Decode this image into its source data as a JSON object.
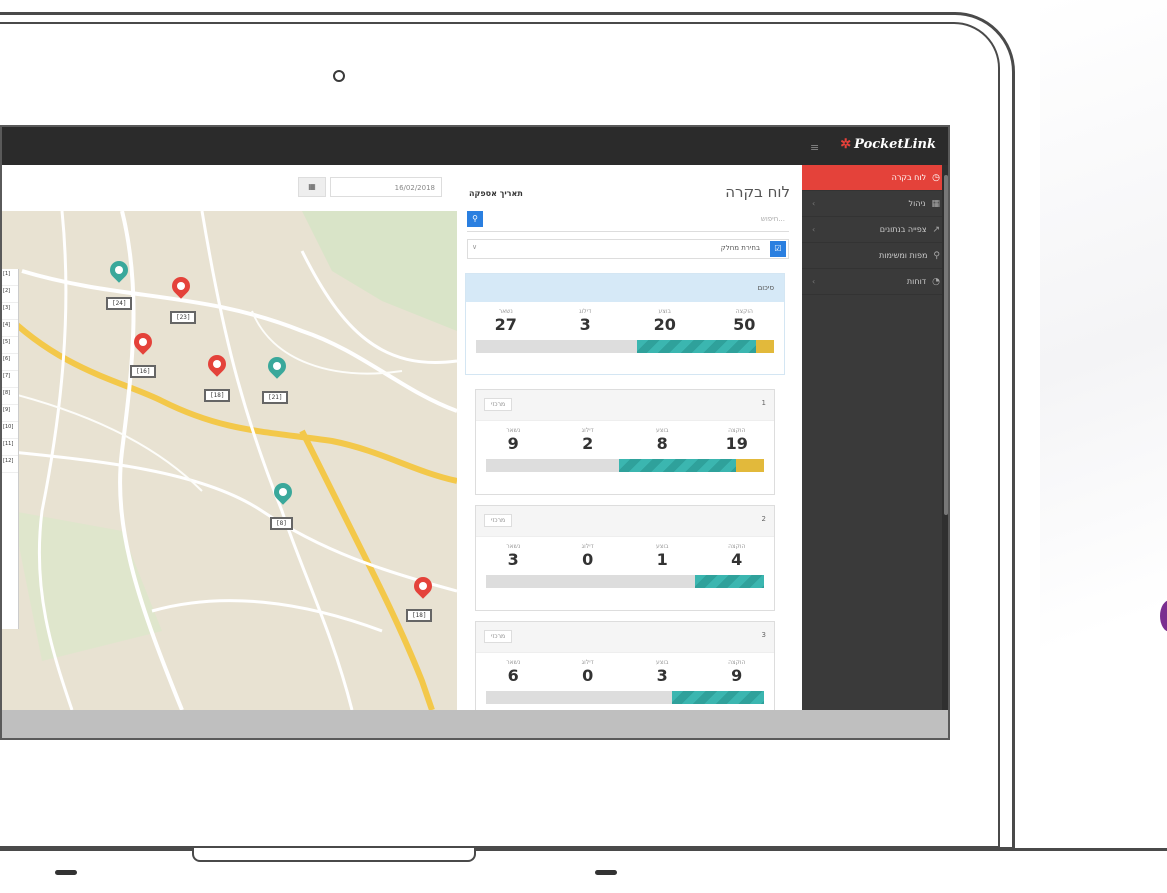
{
  "app": {
    "logo_text": "PocketLink",
    "logo_star": "✲"
  },
  "sidebar": {
    "items": [
      {
        "label": "לוח בקרה",
        "icon": "dashboard-icon",
        "glyph": "◷"
      },
      {
        "label": "ניהול",
        "icon": "grid-icon",
        "glyph": "▦"
      },
      {
        "label": "צפייה בנתונים",
        "icon": "chart-icon",
        "glyph": "↗"
      },
      {
        "label": "מפות ומשימות",
        "icon": "map-pin-icon",
        "glyph": "⚲"
      },
      {
        "label": "דוחות",
        "icon": "clock-icon",
        "glyph": "◔"
      }
    ]
  },
  "map": {
    "date_value": "16/02/2018",
    "calendar_glyph": "▦",
    "pins": [
      {
        "color": "#3aa89b",
        "label": "[24]"
      },
      {
        "color": "#e4423a",
        "label": "[23]"
      },
      {
        "color": "#e4423a",
        "label": "[16]"
      },
      {
        "color": "#e4423a",
        "label": "[18]"
      },
      {
        "color": "#3aa89b",
        "label": "[21]"
      },
      {
        "color": "#3aa89b",
        "label": "[8]"
      },
      {
        "color": "#e4423a",
        "label": "[18]"
      }
    ],
    "legend_rows": [
      "[1]",
      "[2]",
      "[3]",
      "[4]",
      "[5]",
      "[6]",
      "[7]",
      "[8]",
      "[9]",
      "[10]",
      "[11]",
      "[12]"
    ]
  },
  "panel": {
    "title": "לוח בקרה",
    "date_label": "תאריך אספקה",
    "search_placeholder": "חיפוש...",
    "search_glyph": "⚲",
    "select_text": "בחירת מחלק",
    "select_glyph": "☑",
    "select_caret": "∨",
    "summary": {
      "header": "סיכום",
      "stats": [
        {
          "label": "הוקצה",
          "value": "50"
        },
        {
          "label": "בוצע",
          "value": "20"
        },
        {
          "label": "דילוג",
          "value": "3"
        },
        {
          "label": "נשאר",
          "value": "27"
        }
      ],
      "progress": {
        "teal": 0.4,
        "yellow": 0.06
      }
    },
    "cards": [
      {
        "number": "1",
        "tag": "מרכזי",
        "stats": [
          {
            "label": "הוקצה",
            "value": "19"
          },
          {
            "label": "בוצע",
            "value": "8"
          },
          {
            "label": "דילוג",
            "value": "2"
          },
          {
            "label": "נשאר",
            "value": "9"
          }
        ],
        "progress": {
          "teal": 0.42,
          "yellow": 0.1
        }
      },
      {
        "number": "2",
        "tag": "מרכזי",
        "stats": [
          {
            "label": "הוקצה",
            "value": "4"
          },
          {
            "label": "בוצע",
            "value": "1"
          },
          {
            "label": "דילוג",
            "value": "0"
          },
          {
            "label": "נשאר",
            "value": "3"
          }
        ],
        "progress": {
          "teal": 0.25,
          "yellow": 0
        }
      },
      {
        "number": "3",
        "tag": "מרכזי",
        "stats": [
          {
            "label": "הוקצה",
            "value": "9"
          },
          {
            "label": "בוצע",
            "value": "3"
          },
          {
            "label": "דילוג",
            "value": "0"
          },
          {
            "label": "נשאר",
            "value": "6"
          }
        ],
        "progress": {
          "teal": 0.33,
          "yellow": 0
        }
      }
    ]
  },
  "colors": {
    "accent_red": "#e4423a",
    "accent_blue": "#2a7fe0",
    "teal": "#3bb6b0",
    "yellow": "#e2b93b"
  }
}
